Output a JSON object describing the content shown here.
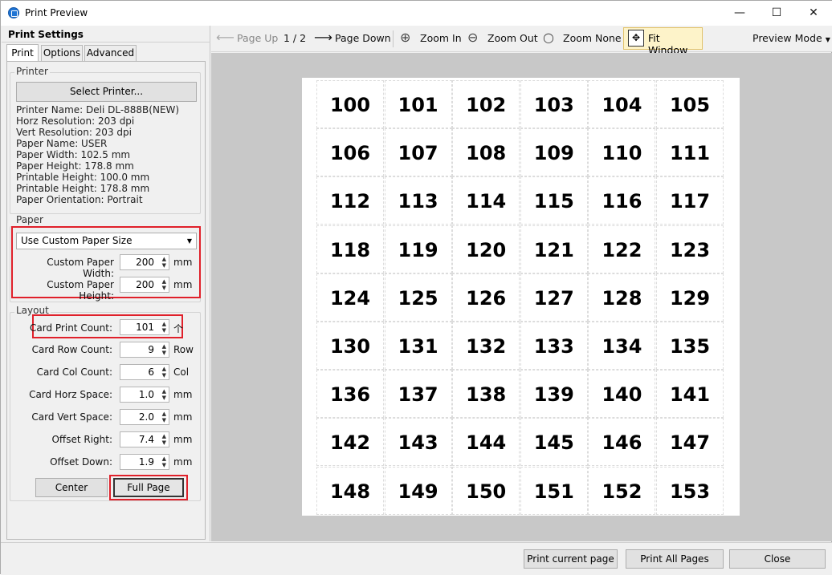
{
  "window": {
    "title": "Print Preview",
    "minimize": "—",
    "maximize": "☐",
    "close": "✕"
  },
  "settings": {
    "title": "Print Settings",
    "tabs": [
      "Print",
      "Options",
      "Advanced"
    ],
    "printer_group": "Printer",
    "select_printer": "Select Printer...",
    "info": [
      "Printer Name: Deli DL-888B(NEW)",
      "Horz Resolution: 203 dpi",
      "Vert Resolution: 203 dpi",
      "Paper Name: USER",
      "Paper Width: 102.5 mm",
      "Paper Height: 178.8 mm",
      "Printable Height: 100.0 mm",
      "Printable Height: 178.8 mm",
      "Paper Orientation: Portrait"
    ],
    "paper_group": "Paper",
    "paper_size": "Use Custom Paper Size",
    "custom_width_label": "Custom Paper Width:",
    "custom_width": "200",
    "custom_height_label": "Custom Paper Height:",
    "custom_height": "200",
    "mm": "mm",
    "layout_group": "Layout",
    "fields": [
      {
        "label": "Card Print Count:",
        "value": "101",
        "unit": "个"
      },
      {
        "label": "Card Row Count:",
        "value": "9",
        "unit": "Row"
      },
      {
        "label": "Card Col Count:",
        "value": "6",
        "unit": "Col"
      },
      {
        "label": "Card Horz Space:",
        "value": "1.0",
        "unit": "mm"
      },
      {
        "label": "Card Vert Space:",
        "value": "2.0",
        "unit": "mm"
      },
      {
        "label": "Offset Right:",
        "value": "7.4",
        "unit": "mm"
      },
      {
        "label": "Offset Down:",
        "value": "1.9",
        "unit": "mm"
      }
    ],
    "center": "Center",
    "full_page": "Full Page"
  },
  "toolbar": {
    "page_up": "Page Up",
    "page_indicator": "1 / 2",
    "page_down": "Page Down",
    "zoom_in": "Zoom In",
    "zoom_out": "Zoom Out",
    "zoom_none": "Zoom None",
    "fit_window": "Fit Window",
    "preview_mode": "Preview Mode"
  },
  "preview": {
    "cards": [
      "100",
      "101",
      "102",
      "103",
      "104",
      "105",
      "106",
      "107",
      "108",
      "109",
      "110",
      "111",
      "112",
      "113",
      "114",
      "115",
      "116",
      "117",
      "118",
      "119",
      "120",
      "121",
      "122",
      "123",
      "124",
      "125",
      "126",
      "127",
      "128",
      "129",
      "130",
      "131",
      "132",
      "133",
      "134",
      "135",
      "136",
      "137",
      "138",
      "139",
      "140",
      "141",
      "142",
      "143",
      "144",
      "145",
      "146",
      "147",
      "148",
      "149",
      "150",
      "151",
      "152",
      "153"
    ]
  },
  "footer": {
    "print_current": "Print current page",
    "print_all": "Print All Pages",
    "close": "Close"
  },
  "colors": {
    "highlight_red": "#e0202a",
    "fit_window_bg": "#fdf3c9",
    "canvas_bg": "#c8c8c8"
  }
}
